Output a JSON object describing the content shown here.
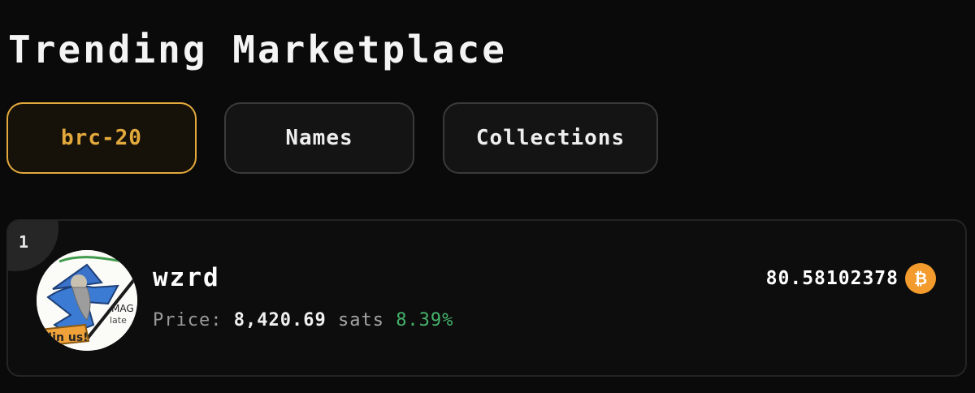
{
  "page": {
    "title": "Trending Marketplace"
  },
  "tabs": [
    {
      "label": "brc-20",
      "active": true
    },
    {
      "label": "Names",
      "active": false
    },
    {
      "label": "Collections",
      "active": false
    }
  ],
  "items": [
    {
      "rank": "1",
      "name": "wzrd",
      "avatar_icon": "wizard-token-avatar",
      "price_label": "Price:",
      "price_value": "8,420.69",
      "price_unit": "sats",
      "price_change": "8.39%",
      "volume": "80.58102378",
      "volume_icon": "bitcoin-icon"
    }
  ],
  "colors": {
    "accent": "#e4a93c",
    "positive": "#45b36b",
    "bitcoin": "#f39b2c",
    "background": "#0a0a0a"
  }
}
